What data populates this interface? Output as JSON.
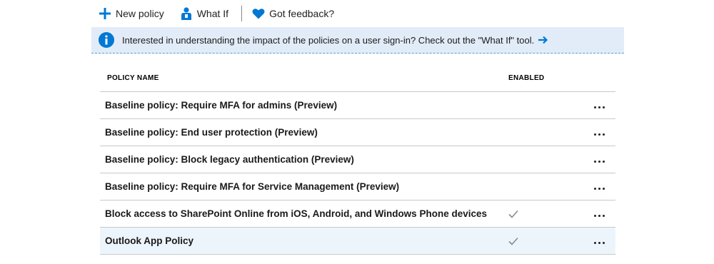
{
  "toolbar": {
    "new_policy_label": "New policy",
    "what_if_label": "What If",
    "feedback_label": "Got feedback?"
  },
  "banner": {
    "text": "Interested in understanding the impact of the policies on a user sign-in? Check out the \"What If\" tool."
  },
  "table": {
    "headers": {
      "name": "POLICY NAME",
      "enabled": "ENABLED"
    },
    "rows": [
      {
        "name": "Baseline policy: Require MFA for admins (Preview)",
        "enabled": false,
        "more": "..."
      },
      {
        "name": "Baseline policy: End user protection (Preview)",
        "enabled": false,
        "more": "..."
      },
      {
        "name": "Baseline policy: Block legacy authentication (Preview)",
        "enabled": false,
        "more": "..."
      },
      {
        "name": "Baseline policy: Require MFA for Service Management (Preview)",
        "enabled": false,
        "more": "..."
      },
      {
        "name": "Block access to SharePoint Online from iOS, Android, and Windows Phone devices",
        "enabled": true,
        "more": "..."
      },
      {
        "name": "Outlook App Policy",
        "enabled": true,
        "more": "...",
        "selected": true
      }
    ]
  },
  "colors": {
    "accent": "#0078d4",
    "banner_bg": "#e2ecf8",
    "check": "#8a8a8a",
    "selected_row": "#edf5fc"
  },
  "icons": {
    "new_policy": "plus-icon",
    "what_if": "person-icon",
    "feedback": "heart-icon",
    "info": "info-icon",
    "arrow": "arrow-right-icon",
    "enabled": "check-icon",
    "more": "ellipsis-icon"
  }
}
